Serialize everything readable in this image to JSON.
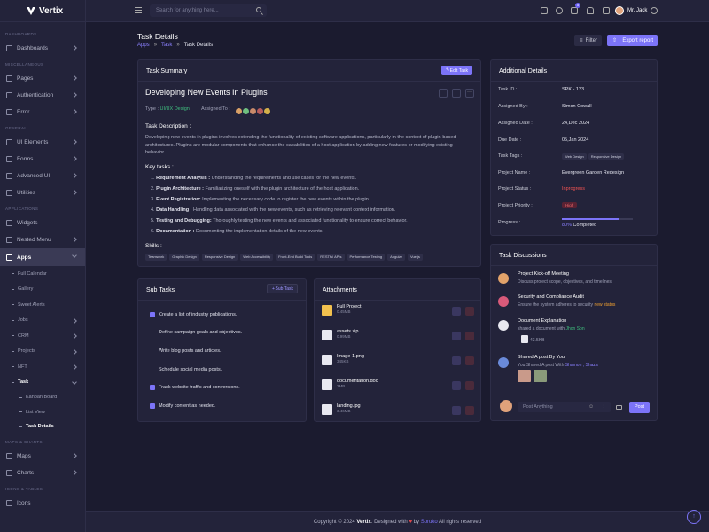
{
  "brand": {
    "name": "Vertix",
    "accent": "#7c74f8"
  },
  "sidebar": {
    "cats": [
      "DASHBOARDS",
      "MISCELLANEOUS",
      "GENERAL",
      "APPLICATIONS",
      "MAPS & CHARTS",
      "ICONS & TABLES"
    ],
    "items": {
      "dashboards": "Dashboards",
      "pages": "Pages",
      "auth": "Authentication",
      "error": "Error",
      "ui": "UI Elements",
      "forms": "Forms",
      "advui": "Advanced UI",
      "utilities": "Utilities",
      "widgets": "Widgets",
      "nested": "Nested Menu",
      "apps": "Apps",
      "maps": "Maps",
      "charts": "Charts",
      "icons": "Icons"
    },
    "apps_sub": [
      "Full Calendar",
      "Gallery",
      "Sweet Alerts",
      "Jobs",
      "CRM",
      "Projects",
      "NFT",
      "Task"
    ],
    "task_sub": [
      "Kanban Board",
      "List View",
      "Task Details"
    ]
  },
  "header": {
    "search_placeholder": "Search for anything here...",
    "cart_badge": "5",
    "user_name": "Mr. Jack"
  },
  "page": {
    "title": "Task Details",
    "crumbs": [
      "Apps",
      "Task",
      "Task Details"
    ],
    "filter": "Filter",
    "export": "Export report"
  },
  "summary": {
    "header": "Task Summary",
    "edit": "Edit Task",
    "title": "Developing New Events In Plugins",
    "type_label": "Type :",
    "type_value": "UI/UX Design",
    "assigned_label": "Assigned To :",
    "desc_h": "Task Description :",
    "desc": "Developing new events in plugins involves extending the functionality of existing software applications, particularly in the context of plugin-based architectures. Plugins are modular components that enhance the capabilities of a host application by adding new features or modifying existing behavior.",
    "kt_h": "Key tasks :",
    "key_tasks": [
      {
        "n": "1.",
        "b": "Requirement Analysis :",
        "t": "Understanding the requirements and use cases for the new events."
      },
      {
        "n": "2.",
        "b": "Plugin Architecture :",
        "t": "Familiarizing oneself with the plugin architecture of the host application."
      },
      {
        "n": "3.",
        "b": "Event Registration:",
        "t": "Implementing the necessary code to register the new events within the plugin."
      },
      {
        "n": "4.",
        "b": "Data Handling :",
        "t": " Handling data associated with the new events, such as retrieving relevant context information."
      },
      {
        "n": "5.",
        "b": "Testing and Debugging:",
        "t": "Thoroughly testing the new events and associated functionality to ensure correct behavior."
      },
      {
        "n": "6.",
        "b": "Documentation :",
        "t": "Documenting the implementation details of the new events."
      }
    ],
    "skills_h": "Skills :",
    "skills": [
      "Teamwork",
      "Graphic Design",
      "Responsive Design",
      "Web Accessibility",
      "Front-End Build Tools",
      "RESTful APIs",
      "Performance Testing",
      "Angular",
      "Vue.js"
    ]
  },
  "additional": {
    "header": "Additional Details",
    "rows": [
      {
        "label": "Task ID :",
        "value": "SPK - 123"
      },
      {
        "label": "Assigned By :",
        "value": "Simon Cowall"
      },
      {
        "label": "Assigned Date :",
        "value": "24,Dec 2024"
      },
      {
        "label": "Due Date :",
        "value": "05,Jan 2024"
      },
      {
        "label": "Task Tags :",
        "value": ""
      },
      {
        "label": "Project Name :",
        "value": "Evergreen Garden Redesign"
      },
      {
        "label": "Project Status :",
        "value": "Inprogress"
      },
      {
        "label": "Project Priority :",
        "value": "High"
      },
      {
        "label": "Progress :",
        "value": ""
      }
    ],
    "tags": [
      "Web Design",
      "Responsive Design"
    ],
    "status_color": "#f05252",
    "priority_bg": "#5a2233",
    "progress_pct": "80%",
    "progress_word": "Completed",
    "progress_value": 0.8
  },
  "discussions": {
    "header": "Task Discussions",
    "items": [
      {
        "title": "Project Kick-off Meeting",
        "sub": "Discuss project scope, objectives, and timelines."
      },
      {
        "title": "Security and Compliance Audit",
        "sub": "Ensure the system adheres to security",
        "hl": "new status"
      },
      {
        "title": "Document Explanation",
        "sub": "shared a document with",
        "hl": "Jhon Son",
        "file": "43.5KB"
      },
      {
        "title": "Shared A post By You",
        "sub": "You Shared A post With",
        "hl": "Shamon , Shaza"
      }
    ],
    "post_placeholder": "Post Anything",
    "post_btn": "Post"
  },
  "subtasks": {
    "header": "Sub Tasks",
    "add": "Sub Task",
    "items": [
      {
        "t": "Create a list of industry publications.",
        "c": true
      },
      {
        "t": "Define campaign goals and objectives.",
        "c": false
      },
      {
        "t": "Write blog posts and articles.",
        "c": false
      },
      {
        "t": "Schedule social media posts.",
        "c": false
      },
      {
        "t": "Track website traffic and conversions.",
        "c": true
      },
      {
        "t": "Modify content as needed.",
        "c": true
      }
    ]
  },
  "attachments": {
    "header": "Attachments",
    "files": [
      {
        "name": "Full Project",
        "size": "0.45MB",
        "color": "#f2c14e"
      },
      {
        "name": "assets.zip",
        "size": "0.99MB",
        "color": "#e8e8f0"
      },
      {
        "name": "Image-1.png",
        "size": "345KB",
        "color": "#e8e8f0"
      },
      {
        "name": "documentation.doc",
        "size": "2MB",
        "color": "#e8e8f0"
      },
      {
        "name": "landing.jpg",
        "size": "3.46MB",
        "color": "#e8e8f0"
      }
    ]
  },
  "footer": {
    "pre": "Copyright © 2024",
    "brand": "Vertix",
    "mid": ". Designed with",
    "by": "by",
    "company": "Spruko",
    "post": "All rights reserved"
  }
}
